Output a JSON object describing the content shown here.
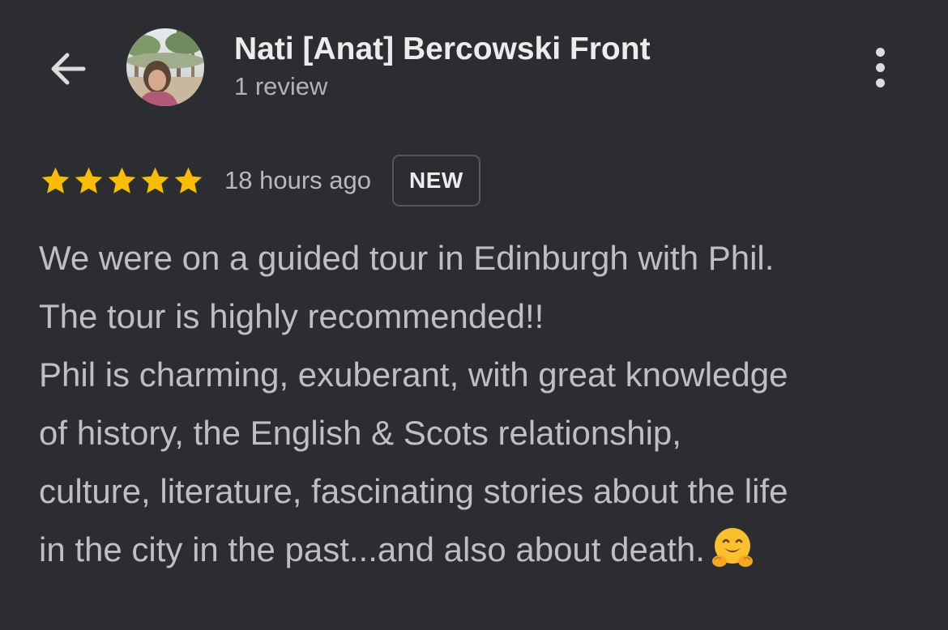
{
  "header": {
    "reviewer_name": "Nati [Anat] Bercowski Front",
    "review_count": "1 review",
    "back_icon": "arrow-left-icon",
    "more_icon": "more-vert-icon"
  },
  "review": {
    "rating": 5,
    "rating_max": 5,
    "time_ago": "18 hours ago",
    "badge": "NEW",
    "lines": [
      "We were on a guided tour in Edinburgh with Phil.",
      "The tour is highly recommended!!",
      "Phil is charming, exuberant, with great knowledge",
      "of history, the English & Scots relationship,",
      "culture, literature, fascinating stories about the life",
      "in the city in the past...and also about death."
    ],
    "trailing_emoji": "hugging-face-icon"
  },
  "colors": {
    "background": "#2b2d31",
    "star": "#fbbc04",
    "text_primary": "#ececec",
    "text_secondary": "#b7b9bc"
  }
}
